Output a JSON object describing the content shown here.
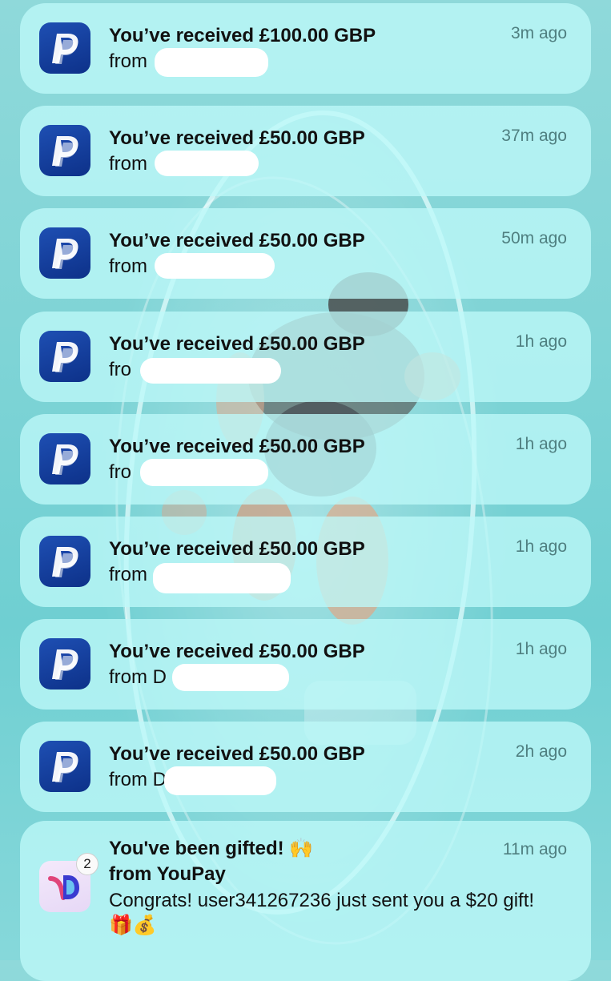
{
  "notifications": [
    {
      "app_icon": "paypal-icon",
      "title": "You’ve received £100.00 GBP",
      "from": "from",
      "time": "3m ago"
    },
    {
      "app_icon": "paypal-icon",
      "title": "You’ve received £50.00 GBP",
      "from": "from",
      "time": "37m ago"
    },
    {
      "app_icon": "paypal-icon",
      "title": "You’ve received £50.00 GBP",
      "from": "from",
      "time": "50m ago"
    },
    {
      "app_icon": "paypal-icon",
      "title": "You’ve received £50.00 GBP",
      "from": "fro",
      "time": "1h ago"
    },
    {
      "app_icon": "paypal-icon",
      "title": "You’ve received £50.00 GBP",
      "from": "fro",
      "time": "1h ago"
    },
    {
      "app_icon": "paypal-icon",
      "title": "You’ve received £50.00 GBP",
      "from": "from",
      "time": "1h ago"
    },
    {
      "app_icon": "paypal-icon",
      "title": "You’ve received £50.00 GBP",
      "from": "from D",
      "time": "1h ago"
    },
    {
      "app_icon": "paypal-icon",
      "title": "You’ve received £50.00 GBP",
      "from": "from D",
      "time": "2h ago"
    }
  ],
  "youpay": {
    "app_icon": "youpay-icon",
    "badge": "2",
    "title": "You've been gifted! 🙌",
    "from": "from YouPay",
    "body": "Congrats! user341267236 just sent you a $20 gift! 🎁💰",
    "time": "11m ago"
  }
}
